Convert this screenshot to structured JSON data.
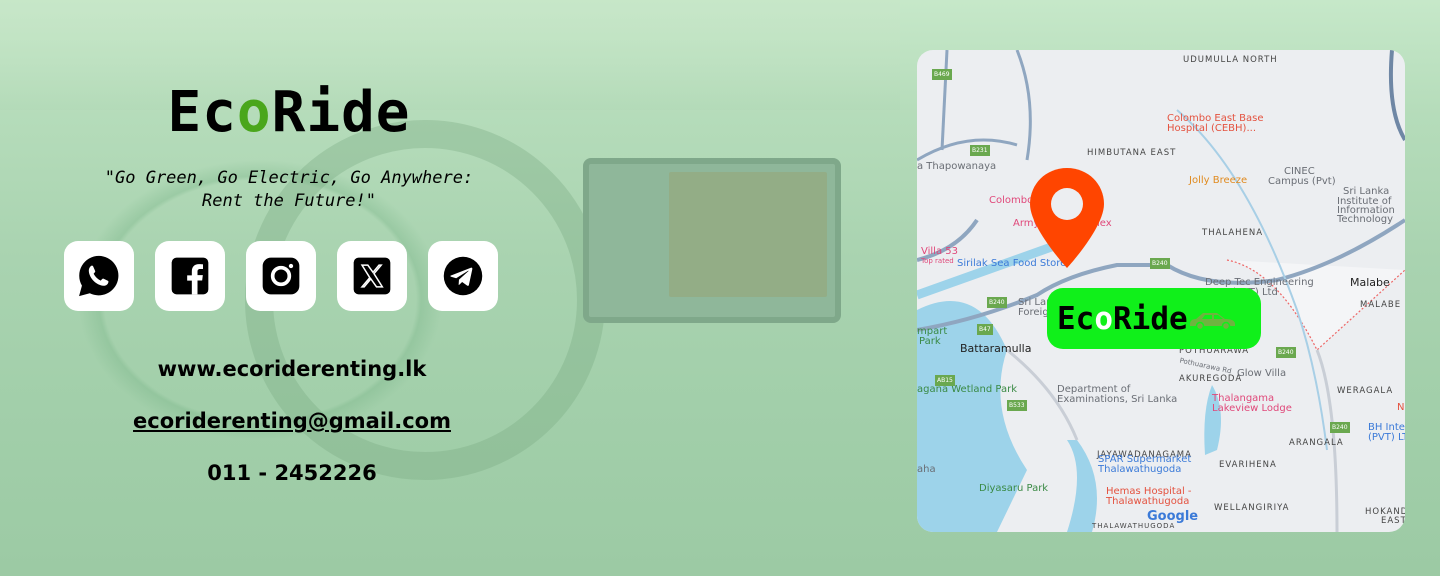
{
  "brand": {
    "pre": "Ec",
    "o": "o",
    "post": "Ride",
    "accent": "#4aa61c"
  },
  "tagline": {
    "line1": "\"Go Green, Go Electric, Go Anywhere:",
    "line2": "Rent the Future!\""
  },
  "socials": [
    {
      "icon": "whatsapp-icon"
    },
    {
      "icon": "facebook-icon"
    },
    {
      "icon": "instagram-icon"
    },
    {
      "icon": "x-icon"
    },
    {
      "icon": "telegram-icon"
    }
  ],
  "contact": {
    "website": "www.ecoriderenting.lk",
    "email": "ecoriderenting@gmail.com",
    "phone": "011 - 2452226"
  },
  "map": {
    "badge": {
      "pre": "Ec",
      "o": "o",
      "post": "Ride",
      "color": "#10f01a"
    },
    "pin_color": "#ff4500",
    "labels": {
      "udumulla": "UDUMULLA NORTH",
      "himbutana": "HIMBUTANA EAST",
      "cebh1": "Colombo East Base",
      "cebh2": "Hospital (CEBH)...",
      "jolly": "Jolly Breeze",
      "cinec1": "CINEC",
      "cinec2": "Campus (Pvt)",
      "slit1": "Sri Lanka",
      "slit2": "Institute of",
      "slit3": "Information",
      "slit4": "Technology",
      "thapo": "a Thapowanaya",
      "colombo": "Colombo",
      "army": "Army",
      "lex": "lex",
      "villa": "Villa 53",
      "toprated": "Top rated",
      "sirilak": "Sirilak Sea Food Store",
      "thalahena": "THALAHENA",
      "deeptec1": "Deep Tec Engineering",
      "deeptec2": "(PVT) Ltd",
      "malabe": "Malabe",
      "malabee": "MALABE E",
      "srilan": "Sri Lan",
      "foreign": "Foreign",
      "rampart": "mpart",
      "park": "Park",
      "battaramulla": "Battaramulla",
      "pothuarawa": "POTHUARAWA",
      "pothrd": "Pothuarawa Rd",
      "akuregoda": "AKUREGODA",
      "glow": "Glow Villa",
      "weragala": "WERAGALA",
      "wetland": "agana Wetland Park",
      "exam1": "Department of",
      "exam2": "Examinations, Sri Lanka",
      "thal1": "Thalangama",
      "thal2": "Lakeview Lodge",
      "bh1": "BH Intern",
      "bh2": "(PVT) LT",
      "ne": "Ne",
      "arangala": "ARANGALA",
      "jaya": "JAYAWADANAGAMA",
      "spar1": "SPAR Supermarket",
      "spar2": "Thalawathugoda",
      "evarihena": "EVARIHENA",
      "diyasaru": "Diyasaru Park",
      "hemas1": "Hemas Hospital -",
      "hemas2": "Thalawathugoda",
      "wellangiriya": "WELLANGIRIYA",
      "hokanda1": "HOKANDA",
      "hokanda2": "EAST",
      "thalawathugoda": "THALAWATHUGODA",
      "aha": "aha",
      "google": "Google",
      "b469": "B469",
      "b231": "B231",
      "b240a": "B240",
      "b240b": "B240",
      "b240c": "B240",
      "b240d": "B240",
      "b47": "B47",
      "ab15": "AB15",
      "b533": "B533"
    }
  }
}
